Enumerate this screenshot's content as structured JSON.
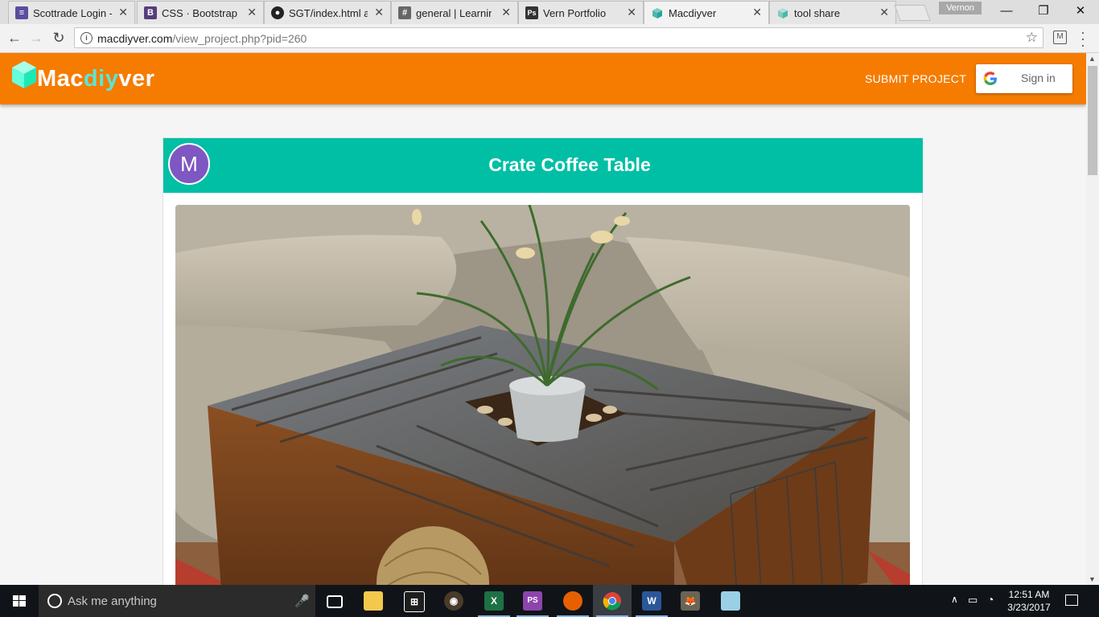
{
  "browser": {
    "tabs": [
      {
        "title": "Scottrade Login -",
        "icon": "scottrade-icon",
        "color": "#5b4d9e",
        "active": false
      },
      {
        "title": "CSS · Bootstrap",
        "icon": "bootstrap-icon",
        "color": "#563d7c",
        "active": false
      },
      {
        "title": "SGT/index.html at",
        "icon": "github-icon",
        "color": "#222222",
        "active": false
      },
      {
        "title": "general | Learning",
        "icon": "slack-hash-icon",
        "color": "#555555",
        "active": false
      },
      {
        "title": "Vern Portfolio",
        "icon": "photoshop-icon",
        "color": "#333333",
        "active": false
      },
      {
        "title": "Macdiyver",
        "icon": "macdiyver-favicon-icon",
        "color": "#4db6ac",
        "active": true
      },
      {
        "title": "tool share",
        "icon": "macdiyver-favicon-icon",
        "color": "#80cbc4",
        "active": false
      }
    ],
    "user_label": "Vernon",
    "url_host": "macdiyver.com",
    "url_path": "/view_project.php?pid=260"
  },
  "site": {
    "logo_text_start": "Mac",
    "logo_text_mid": "diy",
    "logo_text_end": "ver",
    "nav_submit": "SUBMIT PROJECT",
    "signin_label": "Sign in",
    "accent_color": "#f57c00",
    "header_color": "#00bfa5"
  },
  "project": {
    "avatar_letter": "M",
    "avatar_color": "#7e57c2",
    "title": "Crate Coffee Table",
    "photo_subject": "crate-coffee-table-photo"
  },
  "taskbar": {
    "search_placeholder": "Ask me anything",
    "time": "12:51 AM",
    "date": "3/23/2017",
    "apps": [
      {
        "name": "task-view-icon",
        "active": false
      },
      {
        "name": "file-explorer-icon",
        "active": false
      },
      {
        "name": "store-icon",
        "active": false
      },
      {
        "name": "media-player-icon",
        "active": false
      },
      {
        "name": "excel-icon",
        "active": false
      },
      {
        "name": "phpstorm-icon",
        "active": false
      },
      {
        "name": "firefox-icon",
        "active": false
      },
      {
        "name": "chrome-icon",
        "active": true
      },
      {
        "name": "word-icon",
        "active": false
      },
      {
        "name": "gimp-icon",
        "active": false
      },
      {
        "name": "notes-icon",
        "active": false
      }
    ]
  }
}
